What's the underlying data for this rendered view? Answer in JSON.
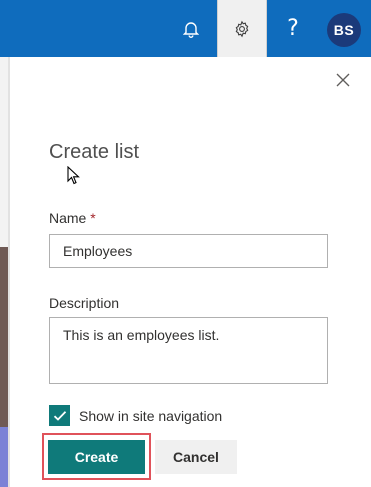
{
  "topbar": {
    "avatar_initials": "BS",
    "help_glyph": "?",
    "icons": [
      "bell-icon",
      "gear-icon",
      "help-icon"
    ],
    "accent_color": "#0f6cbd"
  },
  "panel": {
    "title": "Create list",
    "name_label": "Name",
    "required_marker": "*",
    "name_value": "Employees",
    "description_label": "Description",
    "description_value": "This is an employees list.",
    "show_in_nav_label": "Show in site navigation",
    "show_in_nav_checked": true,
    "create_label": "Create",
    "cancel_label": "Cancel",
    "primary_color": "#0f7a7a"
  }
}
